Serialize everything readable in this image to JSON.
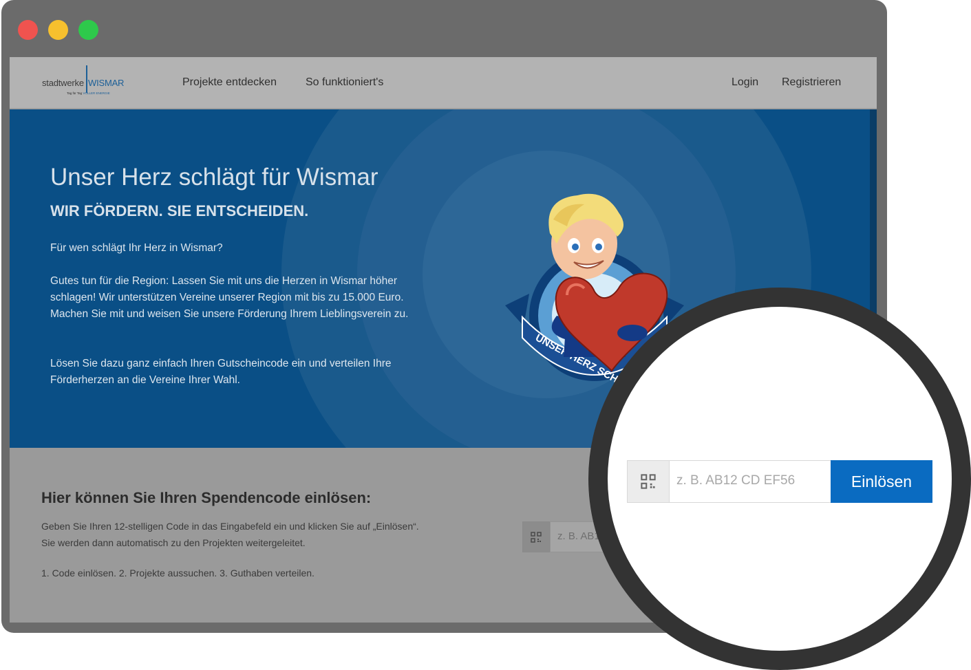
{
  "window": {
    "traffic_lights": [
      "close",
      "minimize",
      "zoom"
    ],
    "colors": {
      "close": "#f0534f",
      "minimize": "#f6c02e",
      "zoom": "#2ec94b"
    }
  },
  "navbar": {
    "logo": {
      "word1": "stadtwerke",
      "word2": "WISMAR",
      "tagline_a": "Tag für Tag",
      "tagline_b": "VOLLER ENERGIE"
    },
    "links": [
      "Projekte entdecken",
      "So funktioniert's"
    ],
    "login": "Login",
    "register": "Registrieren"
  },
  "hero": {
    "title": "Unser Herz schlägt für Wismar",
    "subtitle": "WIR FÖRDERN. SIE ENTSCHEIDEN.",
    "question": "Für wen schlägt Ihr Herz in Wismar?",
    "paragraph": "Gutes tun für die Region: Lassen Sie mit uns die Herzen in Wismar höher schlagen! Wir unterstützen Vereine unserer Region mit bis zu 15.000 Euro. Machen Sie mit und weisen Sie unsere Förderung Ihrem Lieblingsverein zu.",
    "instruction": "Lösen Sie dazu ganz einfach Ihren Gutscheincode ein und verteilen Ihre Förderherzen an die Vereine Ihrer Wahl.",
    "badge_text": "UNSER HERZ SCHLÄGT F",
    "accent": "#0a4f86"
  },
  "redeem": {
    "title": "Hier können Sie Ihren Spendencode einlösen:",
    "description": "Geben Sie Ihren 12-stelligen Code in das Eingabefeld ein und klicken Sie auf „Einlösen“. Sie werden dann automatisch zu den Projekten weitergeleitet.",
    "steps": "1. Code einlösen.  2. Projekte aussuchen.  3. Guthaben verteilen.",
    "small_input_text": "z. B. AB1"
  },
  "magnifier": {
    "placeholder": "z. B. AB12 CD EF56",
    "button": "Einlösen",
    "button_color": "#0a6bc1",
    "icon": "qr-code-icon"
  }
}
